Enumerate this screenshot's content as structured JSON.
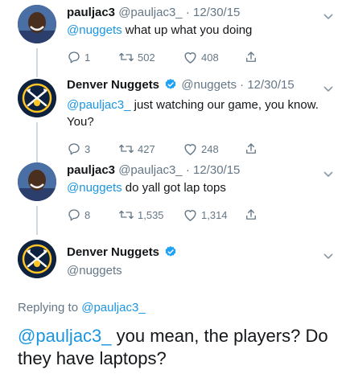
{
  "tweets": [
    {
      "name": "pauljac3",
      "handle": "@pauljac3_",
      "date": "12/30/15",
      "mention": "@nuggets",
      "text": " what up what you doing",
      "replies": "1",
      "retweets": "502",
      "likes": "408"
    },
    {
      "name": "Denver Nuggets",
      "handle": "@nuggets",
      "date": "12/30/15",
      "mention": "@pauljac3_",
      "text": " just watching our game, you know. You?",
      "replies": "3",
      "retweets": "427",
      "likes": "248"
    },
    {
      "name": "pauljac3",
      "handle": "@pauljac3_",
      "date": "12/30/15",
      "mention": "@nuggets",
      "text": " do yall got lap tops",
      "replies": "8",
      "retweets": "1,535",
      "likes": "1,314"
    }
  ],
  "main": {
    "name": "Denver Nuggets",
    "handle": "@nuggets",
    "replying_prefix": "Replying to ",
    "replying_to": "@pauljac3_",
    "mention": "@pauljac3_",
    "text": " you mean, the players? Do they have laptops?"
  },
  "colors": {
    "link": "#1b95e0",
    "muted": "#657786",
    "nuggets_navy": "#0e2240",
    "nuggets_gold": "#fec524"
  },
  "icons": [
    "reply-icon",
    "retweet-icon",
    "like-icon",
    "share-icon",
    "verified-badge-icon",
    "chevron-down-icon"
  ]
}
